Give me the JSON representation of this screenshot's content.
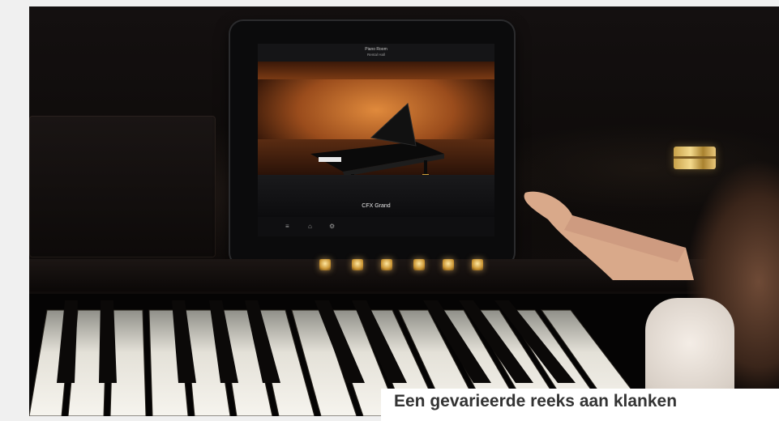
{
  "photo": {
    "tablet": {
      "screen": {
        "title": "Piano Room",
        "subtitle": "Rental Hall",
        "voice_name": "CFX Grand"
      }
    }
  },
  "caption": {
    "text": "Een gevarieerde reeks aan klanken"
  },
  "colors": {
    "piano_black": "#0e0b0a",
    "hall_orange": "#e08a3c",
    "brass": "#c8a24a",
    "caption_text": "#333333"
  }
}
